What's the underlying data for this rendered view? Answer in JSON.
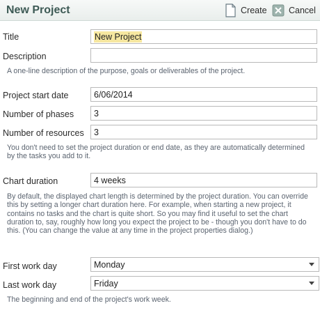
{
  "header": {
    "title": "New Project",
    "create_label": "Create",
    "cancel_label": "Cancel"
  },
  "fields": {
    "title": {
      "label": "Title",
      "value": "New Project"
    },
    "description": {
      "label": "Description",
      "value": "",
      "help": "A one-line description of the purpose, goals or deliverables of the project."
    },
    "start_date": {
      "label": "Project start date",
      "value": "6/06/2014"
    },
    "phases": {
      "label": "Number of phases",
      "value": "3"
    },
    "resources": {
      "label": "Number of resources",
      "value": "3",
      "help": "You don't need to set the project duration or end date, as they are automatically determined by the tasks you add to it."
    },
    "chart_duration": {
      "label": "Chart duration",
      "value": "4 weeks",
      "help": "By default, the displayed chart length is determined by the project duration. You can override this by setting a longer chart duration here. For example, when starting a new project, it contains no tasks and the chart is quite short. So you may find it useful to set the chart duration to, say, roughly how long you expect the project to be - though you don't have to do this. (You can change the value at any time in the project properties dialog.)"
    },
    "first_work_day": {
      "label": "First work day",
      "value": "Monday"
    },
    "last_work_day": {
      "label": "Last work day",
      "value": "Friday",
      "help": "The beginning and end of the project's work week."
    }
  }
}
